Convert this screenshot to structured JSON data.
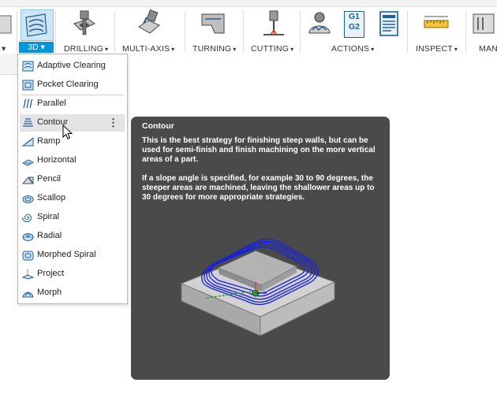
{
  "toolbar": {
    "groups": [
      {
        "label": "3D"
      },
      {
        "label": "DRILLING"
      },
      {
        "label": "MULTI-AXIS"
      },
      {
        "label": "TURNING"
      },
      {
        "label": "CUTTING"
      },
      {
        "label": "ACTIONS"
      },
      {
        "label": "INSPECT"
      },
      {
        "label": "MAN"
      }
    ],
    "actions_icon_text": [
      "G1",
      "G2"
    ],
    "caret": "▾"
  },
  "menu": {
    "items": [
      {
        "label": "Adaptive Clearing",
        "icon": "adaptive-clearing-icon"
      },
      {
        "label": "Pocket Clearing",
        "icon": "pocket-clearing-icon"
      },
      {
        "label": "Parallel",
        "icon": "parallel-icon"
      },
      {
        "label": "Contour",
        "icon": "contour-icon",
        "more": "⋮"
      },
      {
        "label": "Ramp",
        "icon": "ramp-icon"
      },
      {
        "label": "Horizontal",
        "icon": "horizontal-icon"
      },
      {
        "label": "Pencil",
        "icon": "pencil-icon"
      },
      {
        "label": "Scallop",
        "icon": "scallop-icon"
      },
      {
        "label": "Spiral",
        "icon": "spiral-icon"
      },
      {
        "label": "Radial",
        "icon": "radial-icon"
      },
      {
        "label": "Morphed Spiral",
        "icon": "morphed-spiral-icon"
      },
      {
        "label": "Project",
        "icon": "project-icon"
      },
      {
        "label": "Morph",
        "icon": "morph-icon"
      }
    ]
  },
  "tooltip": {
    "title": "Contour",
    "p1": "This is the best strategy for finishing steep walls, but can be used for semi-finish and finish machining on the more vertical areas of a part.",
    "p2": "If a slope angle is specified, for example 30 to 90 degrees, the steeper areas are machined, leaving the shallower areas up to 30 degrees for more appropriate strategies."
  },
  "colors": {
    "accent": "#0696d7",
    "tooltip_bg": "#4a4a4a",
    "toolpath": "#1a22d8"
  }
}
